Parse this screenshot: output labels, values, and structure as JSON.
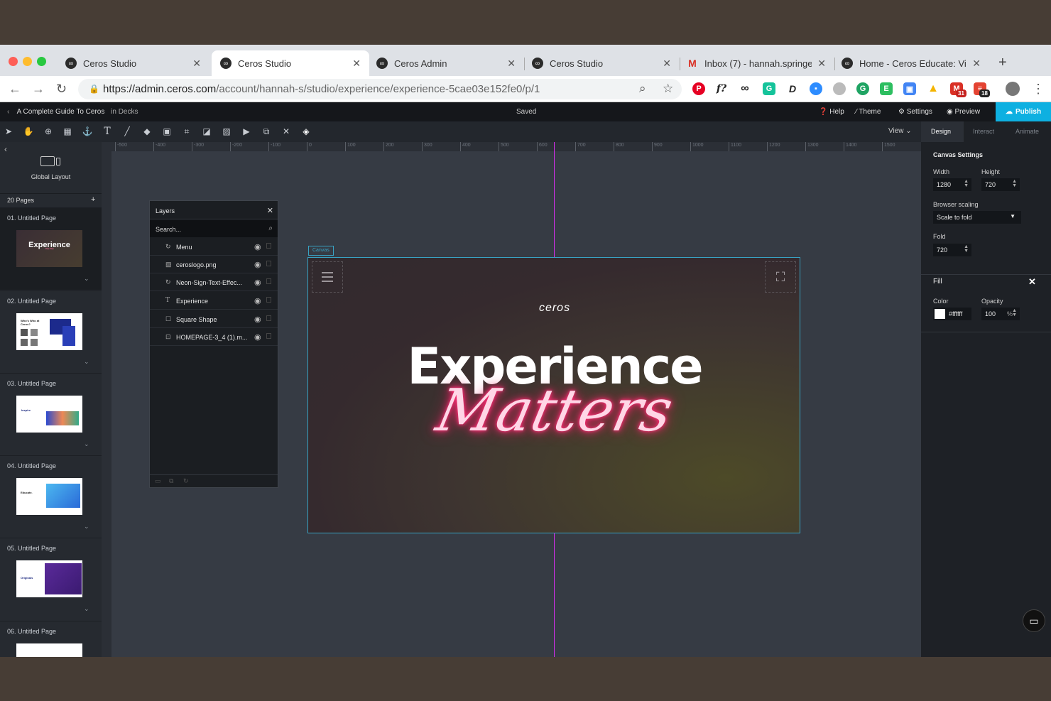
{
  "browser": {
    "tabs": [
      {
        "title": "Ceros Studio",
        "icon": "ceros-icon",
        "active": false
      },
      {
        "title": "Ceros Studio",
        "icon": "ceros-icon",
        "active": true
      },
      {
        "title": "Ceros Admin",
        "icon": "ceros-icon",
        "active": false
      },
      {
        "title": "Ceros Studio",
        "icon": "ceros-icon",
        "active": false
      },
      {
        "title": "Inbox (7) - hannah.springe",
        "icon": "gmail-icon",
        "active": false
      },
      {
        "title": "Home - Ceros Educate: Vi",
        "icon": "ceros-icon",
        "active": false
      }
    ],
    "url_host": "https://admin.ceros.com",
    "url_path": "/account/hannah-s/studio/experience/experience-5cae03e152fe0/p/1",
    "badges": {
      "calendar": "31",
      "todoist": "18"
    }
  },
  "app": {
    "breadcrumb": "A Complete Guide To Ceros",
    "breadcrumb_location": "in Decks",
    "status": "Saved",
    "actions": {
      "help": "Help",
      "theme": "Theme",
      "settings": "Settings",
      "preview": "Preview",
      "publish": "Publish"
    },
    "view_label": "View",
    "ruler_ticks": [
      "-500",
      "-400",
      "-300",
      "-200",
      "-100",
      "0",
      "100",
      "200",
      "300",
      "400",
      "500",
      "600",
      "700",
      "800",
      "900",
      "1000",
      "1100",
      "1200",
      "1300",
      "1400",
      "1500"
    ]
  },
  "sidebar": {
    "global_layout": "Global Layout",
    "pages_count": "20 Pages",
    "pages": [
      {
        "label": "01. Untitled Page",
        "active": true
      },
      {
        "label": "02. Untitled Page",
        "active": false
      },
      {
        "label": "03. Untitled Page",
        "active": false
      },
      {
        "label": "04. Untitled Page",
        "active": false
      },
      {
        "label": "05. Untitled Page",
        "active": false
      },
      {
        "label": "06. Untitled Page",
        "active": false
      }
    ],
    "thumb_texts": {
      "p1_title": "Experience",
      "p2_title": "Who's Who at Ceros?",
      "p3_title": "Inspire",
      "p4_title": "Educate.",
      "p5_title": "Originals"
    }
  },
  "layers": {
    "title": "Layers",
    "search_placeholder": "Search...",
    "items": [
      {
        "name": "Menu",
        "icon": "sync-icon"
      },
      {
        "name": "ceroslogo.png",
        "icon": "image-icon"
      },
      {
        "name": "Neon-Sign-Text-Effec...",
        "icon": "sync-icon"
      },
      {
        "name": "Experience",
        "icon": "text-icon"
      },
      {
        "name": "Square Shape",
        "icon": "square-icon"
      },
      {
        "name": "HOMEPAGE-3_4 (1).m...",
        "icon": "video-icon"
      }
    ]
  },
  "canvas": {
    "tag": "Canvas",
    "logo_text": "ceros",
    "headline": "Experience",
    "neon_text": "Matters"
  },
  "right_panel": {
    "tabs": [
      "Design",
      "Interact",
      "Animate"
    ],
    "section_title": "Canvas Settings",
    "width_label": "Width",
    "width_value": "1280",
    "height_label": "Height",
    "height_value": "720",
    "browser_scaling_label": "Browser scaling",
    "browser_scaling_value": "Scale to fold",
    "fold_label": "Fold",
    "fold_value": "720",
    "fill_title": "Fill",
    "color_label": "Color",
    "color_value": "#ffffff",
    "opacity_label": "Opacity",
    "opacity_value": "100",
    "opacity_unit": "%"
  },
  "colors": {
    "accent": "#0eb0e1",
    "canvas_border": "#38a3c4",
    "guide": "#d82ef0",
    "neon": "#ff2d75"
  }
}
